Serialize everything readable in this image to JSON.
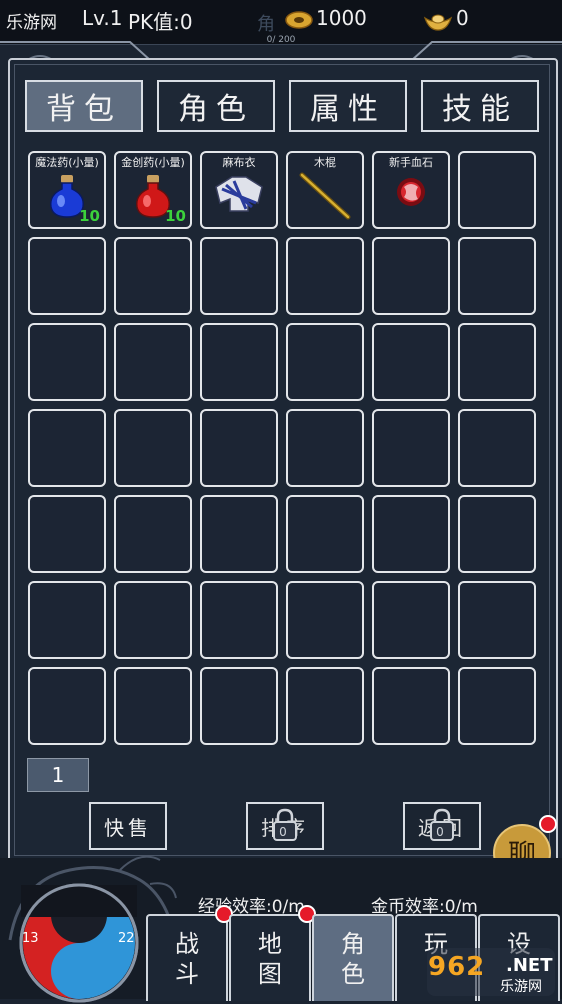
{
  "topbar": {
    "site": "乐游网",
    "level": "Lv.1",
    "pk": "PK值:0",
    "gold": "1000",
    "ingot": "0",
    "exp": "0/ 200",
    "watermark_char": "角"
  },
  "tabs": [
    {
      "label": "背包",
      "active": true
    },
    {
      "label": "角色",
      "active": false
    },
    {
      "label": "属性",
      "active": false
    },
    {
      "label": "技能",
      "active": false
    }
  ],
  "items": [
    {
      "name": "魔法药(小量)",
      "count": "10",
      "icon": "blue-potion-icon",
      "color": "#1a3bd6"
    },
    {
      "name": "金创药(小量)",
      "count": "10",
      "icon": "red-potion-icon",
      "color": "#d01818"
    },
    {
      "name": "麻布衣",
      "count": "",
      "icon": "cloth-armor-icon",
      "color": "#c8ccd8"
    },
    {
      "name": "木棍",
      "count": "",
      "icon": "wooden-staff-icon",
      "color": "#c8a020"
    },
    {
      "name": "新手血石",
      "count": "",
      "icon": "blood-stone-icon",
      "color": "#c02020"
    },
    {
      "name": "",
      "count": "",
      "icon": "",
      "color": ""
    }
  ],
  "grid": {
    "rows": 7,
    "cols": 6
  },
  "page": "1",
  "actions": {
    "quick_sell": "快售",
    "sort": "排序",
    "recycle": "返回"
  },
  "efficiency": {
    "exp": "经验效率:0/m",
    "gold": "金币效率:0/m"
  },
  "orb": {
    "hp": "13",
    "mp": "22"
  },
  "chat": "聊",
  "nav": [
    {
      "l1": "战",
      "l2": "斗",
      "active": false
    },
    {
      "l1": "地",
      "l2": "图",
      "active": false
    },
    {
      "l1": "角",
      "l2": "色",
      "active": true
    },
    {
      "l1": "玩",
      "l2": "",
      "active": false
    },
    {
      "l1": "设",
      "l2": "",
      "active": false
    }
  ],
  "watermark": {
    "num": "962",
    "net": ".NET",
    "cn": "乐游网"
  }
}
